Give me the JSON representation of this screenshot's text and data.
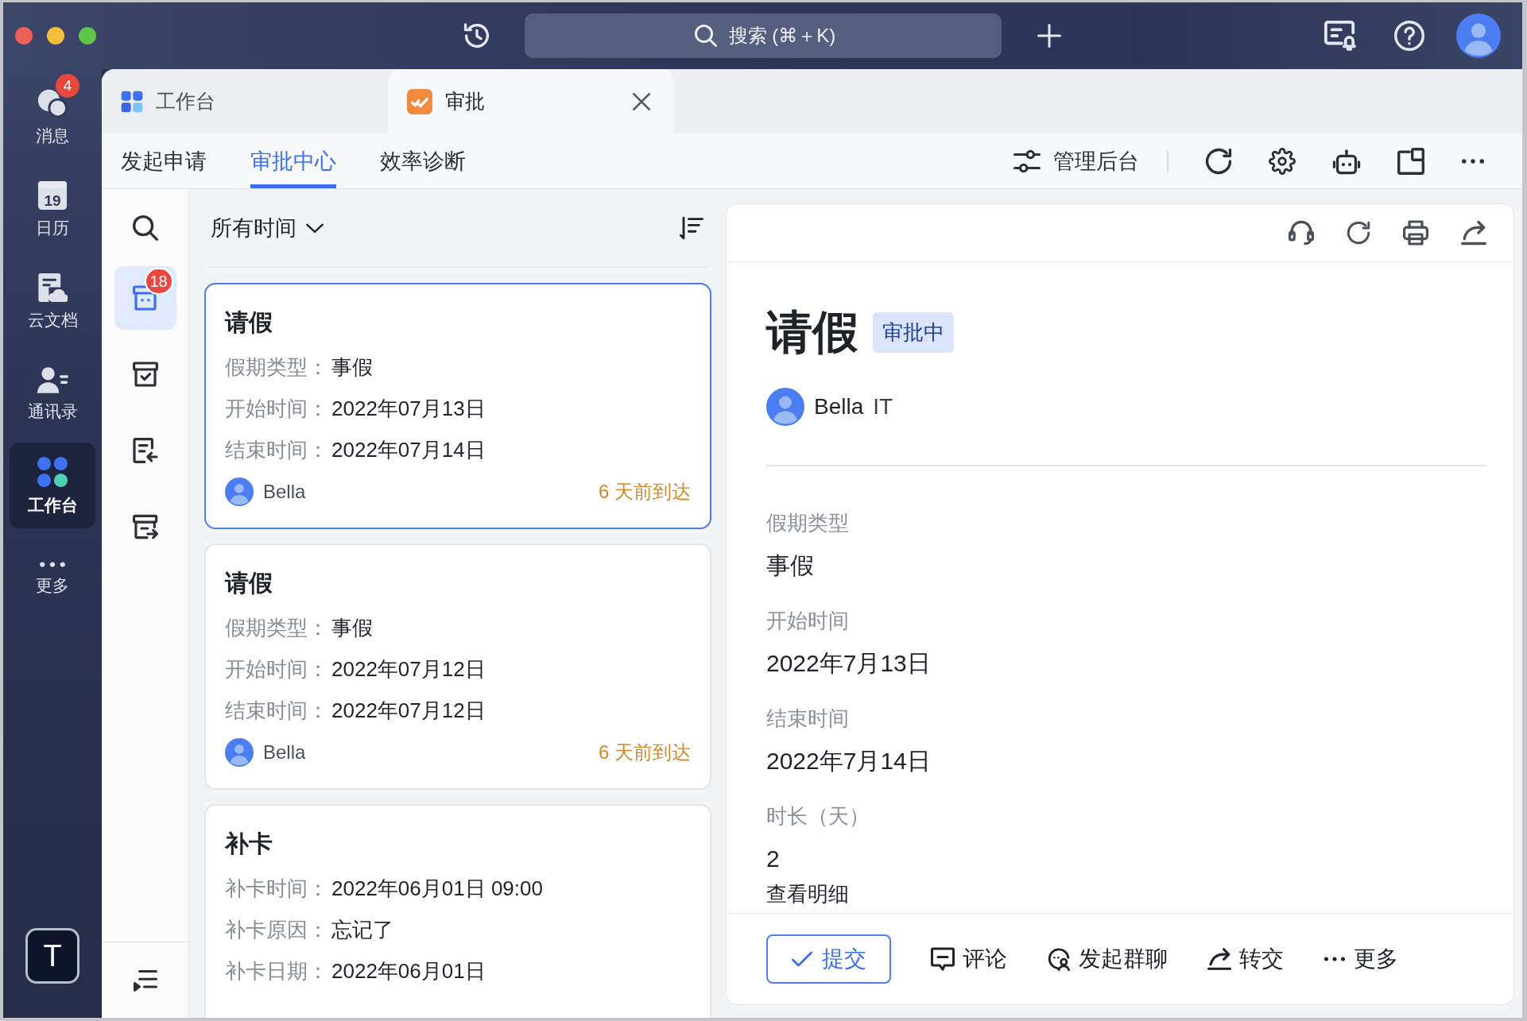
{
  "window": {
    "search": {
      "placeholder": "搜索 (⌘＋K)"
    }
  },
  "rail": {
    "items": [
      {
        "kind": "chat",
        "label": "消息",
        "badge": "4",
        "selected": false
      },
      {
        "kind": "calendar",
        "label": "日历",
        "date": "19",
        "selected": false
      },
      {
        "kind": "docs",
        "label": "云文档",
        "selected": false
      },
      {
        "kind": "contacts",
        "label": "通讯录",
        "selected": false
      },
      {
        "kind": "workspace",
        "label": "工作台",
        "selected": true
      },
      {
        "kind": "more",
        "label": "更多",
        "selected": false
      }
    ],
    "user_initial": "T"
  },
  "tabs": [
    {
      "kind": "workspace",
      "label": "工作台",
      "selected": false
    },
    {
      "kind": "approval",
      "label": "审批",
      "selected": true
    }
  ],
  "nav": {
    "tabs": [
      {
        "label": "发起申请",
        "selected": false
      },
      {
        "label": "审批中心",
        "selected": true
      },
      {
        "label": "效率诊断",
        "selected": false
      }
    ],
    "admin_label": "管理后台"
  },
  "side_icons": [
    {
      "kind": "inbox",
      "selected": true,
      "badge": "18"
    },
    {
      "kind": "done",
      "selected": false
    },
    {
      "kind": "received",
      "selected": false
    },
    {
      "kind": "sent",
      "selected": false
    }
  ],
  "list": {
    "filter": "所有时间",
    "cards": [
      {
        "title": "请假",
        "selected": true,
        "fields": [
          {
            "label": "假期类型：",
            "value": "事假"
          },
          {
            "label": "开始时间：",
            "value": "2022年07月13日"
          },
          {
            "label": "结束时间：",
            "value": "2022年07月14日"
          }
        ],
        "submitter": {
          "kind": "person",
          "name": "Bella"
        },
        "arrived": "6 天前到达"
      },
      {
        "title": "请假",
        "selected": false,
        "fields": [
          {
            "label": "假期类型：",
            "value": "事假"
          },
          {
            "label": "开始时间：",
            "value": "2022年07月12日"
          },
          {
            "label": "结束时间：",
            "value": "2022年07月12日"
          }
        ],
        "submitter": {
          "kind": "person",
          "name": "Bella"
        },
        "arrived": "6 天前到达"
      },
      {
        "title": "补卡",
        "selected": false,
        "fields": [
          {
            "label": "补卡时间：",
            "value": "2022年06月01日 09:00"
          },
          {
            "label": "补卡原因：",
            "value": "忘记了"
          },
          {
            "label": "补卡日期：",
            "value": "2022年06月01日"
          }
        ]
      }
    ]
  },
  "detail": {
    "title": "请假",
    "status": "审批中",
    "applicant": {
      "kind": "person",
      "name": "Bella",
      "dept": "IT"
    },
    "fields": [
      {
        "label": "假期类型",
        "value": "事假"
      },
      {
        "label": "开始时间",
        "value": "2022年7月13日"
      },
      {
        "label": "结束时间",
        "value": "2022年7月14日"
      },
      {
        "label": "时长（天）",
        "value": "2"
      }
    ],
    "link": "查看明细",
    "actions": [
      {
        "kind": "submit",
        "label": "提交"
      },
      {
        "kind": "comment",
        "label": "评论"
      },
      {
        "kind": "group-chat",
        "label": "发起群聊"
      },
      {
        "kind": "transfer",
        "label": "转交"
      },
      {
        "kind": "more",
        "label": "更多"
      }
    ]
  }
}
